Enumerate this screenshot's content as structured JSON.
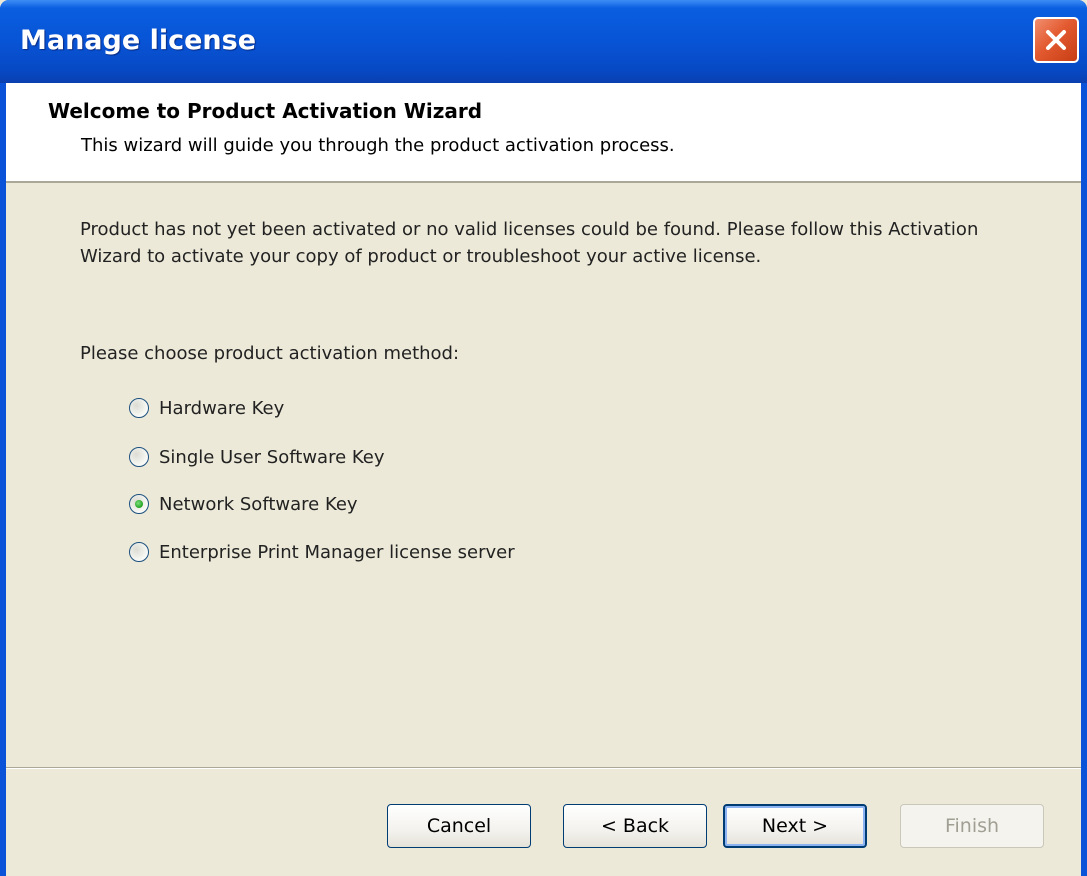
{
  "window": {
    "title": "Manage license"
  },
  "header": {
    "title": "Welcome to Product Activation Wizard",
    "subtitle": "This wizard will guide you through the product activation process."
  },
  "body": {
    "intro": "Product has not yet been activated or no valid licenses could be found. Please follow this Activation Wizard to activate your copy of product or troubleshoot your active license.",
    "choose_label": "Please choose product activation method:",
    "options": [
      {
        "label": "Hardware Key",
        "selected": false
      },
      {
        "label": "Single User Software Key",
        "selected": false
      },
      {
        "label": "Network Software Key",
        "selected": true
      },
      {
        "label": "Enterprise Print Manager license server",
        "selected": false
      }
    ]
  },
  "buttons": {
    "cancel": "Cancel",
    "back": "< Back",
    "next": "Next >",
    "finish": "Finish"
  },
  "colors": {
    "titlebar": "#0854d6",
    "dialog_bg": "#ece9d8",
    "close_button": "#e35a30",
    "radio_selected": "#21a121"
  }
}
